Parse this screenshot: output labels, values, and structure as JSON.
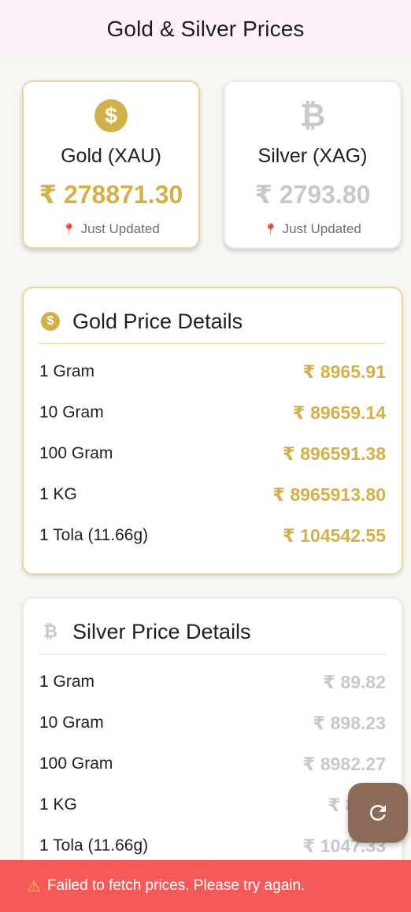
{
  "app": {
    "title": "Gold & Silver Prices"
  },
  "summary": {
    "gold": {
      "icon": "dollar-coin-icon",
      "name": "Gold (XAU)",
      "price": "₹ 278871.30",
      "updated": "Just Updated"
    },
    "silver": {
      "icon": "bitcoin-icon",
      "name": "Silver (XAG)",
      "price": "₹ 2793.80",
      "updated": "Just Updated"
    }
  },
  "gold_details": {
    "title": "Gold Price Details",
    "rows": [
      {
        "label": "1 Gram",
        "value": "₹ 8965.91"
      },
      {
        "label": "10 Gram",
        "value": "₹ 89659.14"
      },
      {
        "label": "100 Gram",
        "value": "₹ 896591.38"
      },
      {
        "label": "1 KG",
        "value": "₹ 8965913.80"
      },
      {
        "label": "1 Tola (11.66g)",
        "value": "₹ 104542.55"
      }
    ]
  },
  "silver_details": {
    "title": "Silver Price Details",
    "rows": [
      {
        "label": "1 Gram",
        "value": "₹ 89.82"
      },
      {
        "label": "10 Gram",
        "value": "₹ 898.23"
      },
      {
        "label": "100 Gram",
        "value": "₹ 8982.27"
      },
      {
        "label": "1 KG",
        "value": "₹ 8982"
      },
      {
        "label": "1 Tola (11.66g)",
        "value": "₹ 1047.33"
      }
    ]
  },
  "fab": {
    "icon": "refresh-icon"
  },
  "snackbar": {
    "icon": "warning-icon",
    "message": "Failed to fetch prices. Please try again."
  },
  "colors": {
    "gold": "#d4b04a",
    "silver": "#c8c8c8",
    "appbar": "#fcf1fa",
    "fab": "#8c6a58",
    "error": "#f55a58"
  }
}
